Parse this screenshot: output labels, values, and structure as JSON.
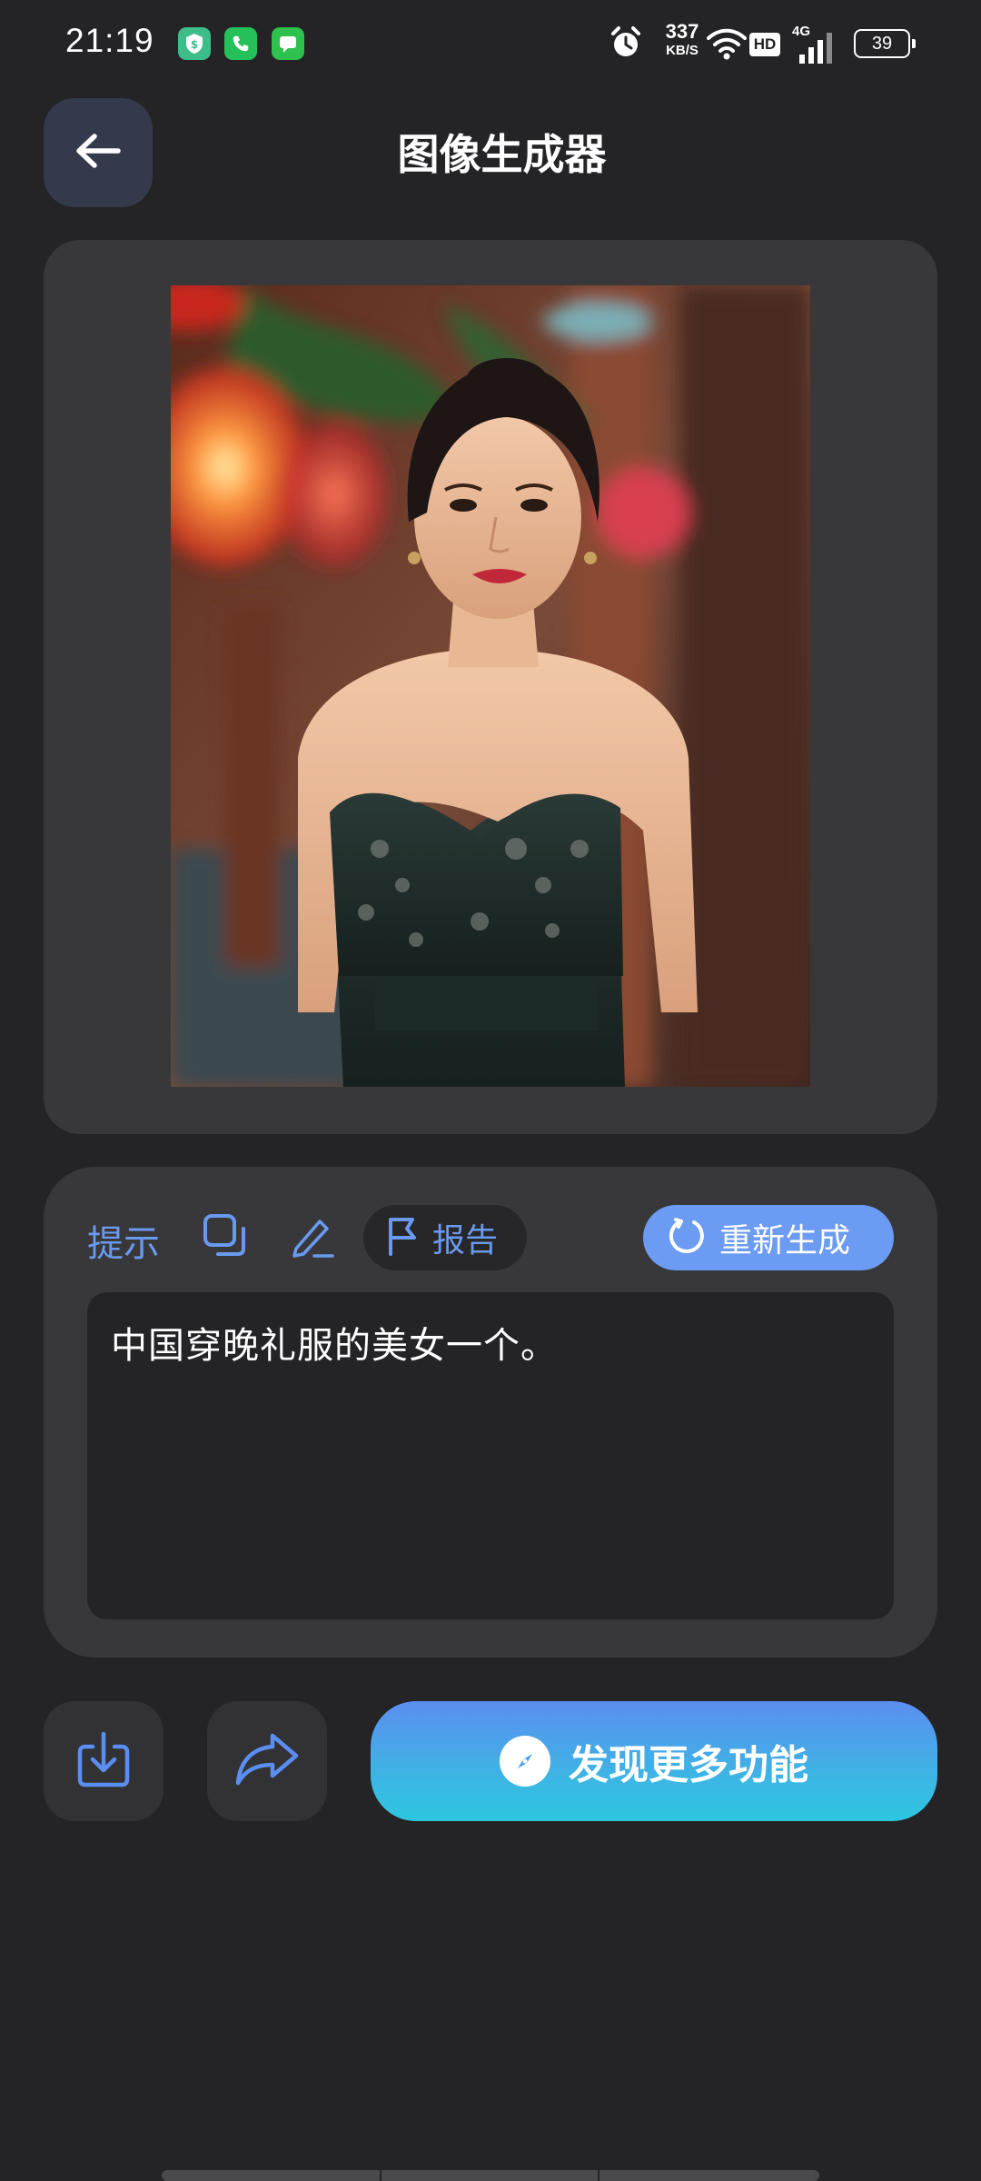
{
  "status_bar": {
    "time": "21:19",
    "notification_icons": [
      "shield-app-icon",
      "phone-icon",
      "messages-icon"
    ],
    "network_speed": "337",
    "network_speed_unit": "KB/S",
    "hd_label": "HD",
    "network_type": "4G",
    "battery": "39"
  },
  "header": {
    "back_icon": "arrow-left-icon",
    "title": "图像生成器"
  },
  "image": {
    "description_icon": "generated-portrait-image"
  },
  "prompt_panel": {
    "label": "提示",
    "copy_icon": "copy-icon",
    "edit_icon": "pencil-icon",
    "report_label": "报告",
    "regenerate_label": "重新生成",
    "prompt_text": "中国穿晚礼服的美女一个。"
  },
  "actions": {
    "download_icon": "download-icon",
    "share_icon": "share-icon",
    "discover_label": "发现更多功能",
    "discover_icon": "compass-icon"
  },
  "colors": {
    "background": "#242325",
    "card": "#38383a",
    "accent": "#6a9af0",
    "regenerate_button": "#6b9bf3"
  }
}
